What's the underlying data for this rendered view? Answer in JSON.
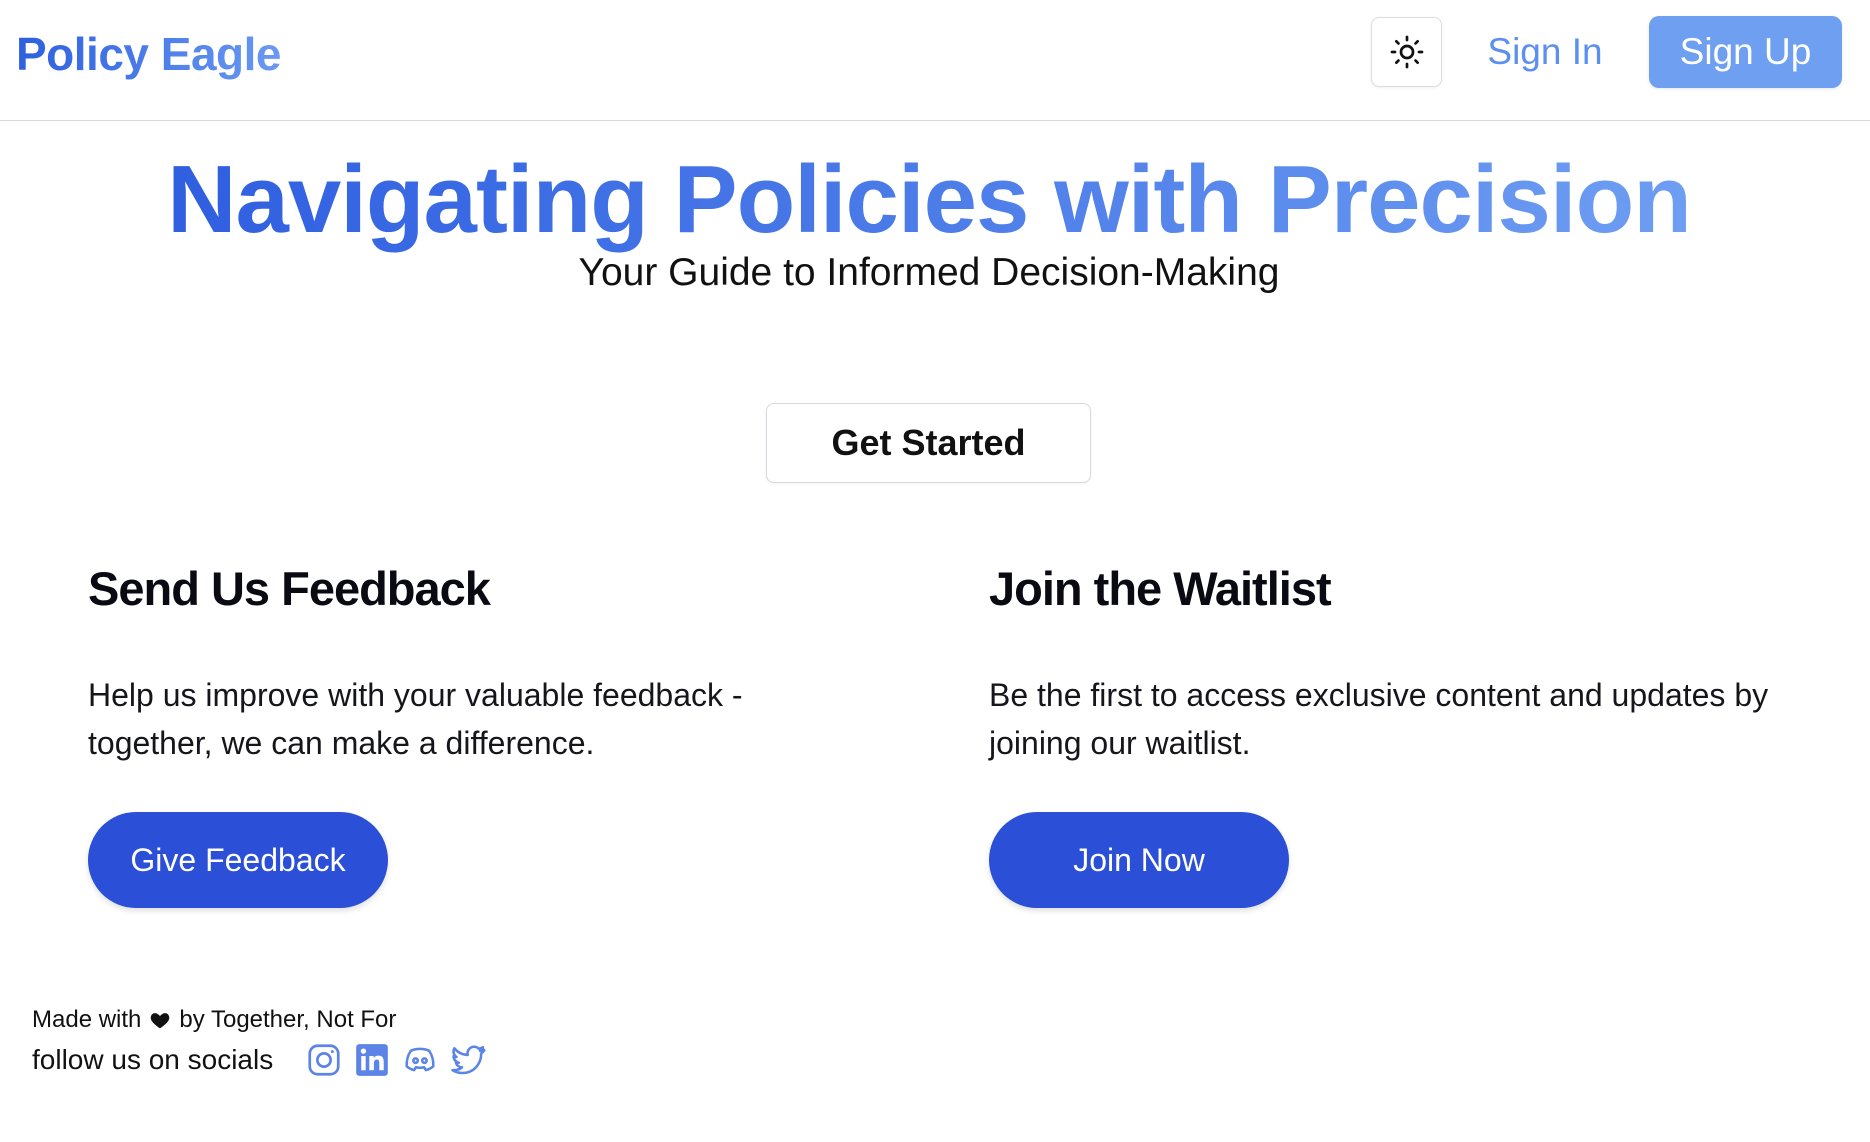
{
  "header": {
    "brand": "Policy Eagle",
    "theme_toggle_icon": "sun-icon",
    "sign_in": "Sign In",
    "sign_up": "Sign Up"
  },
  "hero": {
    "title": "Navigating Policies with Precision",
    "subtitle": "Your Guide to Informed Decision-Making",
    "cta": "Get Started"
  },
  "cards": {
    "feedback": {
      "title": "Send Us Feedback",
      "body": "Help us improve with your valuable feedback - together, we can make a difference.",
      "button": "Give Feedback"
    },
    "waitlist": {
      "title": "Join the Waitlist",
      "body": "Be the first to access exclusive content and updates by joining our waitlist.",
      "button": "Join Now"
    }
  },
  "footer": {
    "made_with_prefix": "Made with",
    "made_with_suffix": "by Together, Not For",
    "follow": "follow us on socials",
    "socials": [
      "instagram-icon",
      "linkedin-icon",
      "discord-icon",
      "twitter-icon"
    ]
  },
  "colors": {
    "brand_gradient_start": "#2d5fe0",
    "brand_gradient_end": "#6a9af2",
    "link": "#5b8ff0",
    "sign_up_bg": "#6f9ff1",
    "primary_button": "#2b4fd6",
    "social_icon": "#5b84e6"
  }
}
